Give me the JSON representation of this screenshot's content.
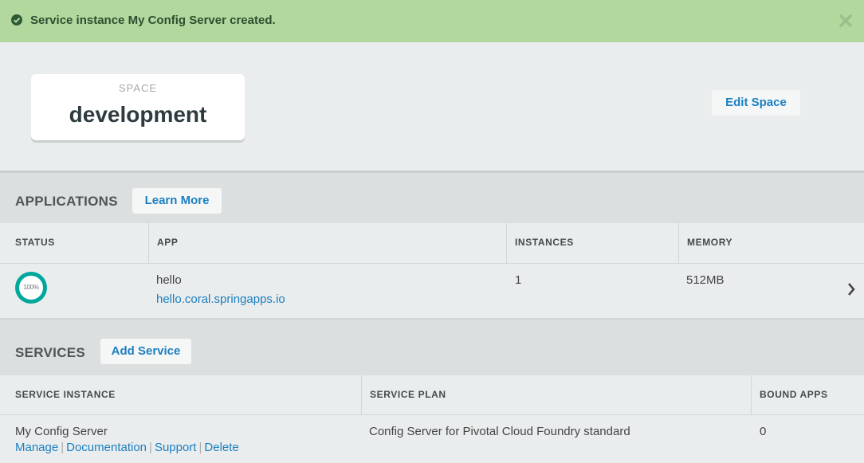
{
  "alert": {
    "prefix": "Service instance",
    "name": "My Config Server",
    "suffix": "created.",
    "status_color": "#b2d89e"
  },
  "space": {
    "label": "SPACE",
    "name": "development",
    "edit_label": "Edit Space"
  },
  "applications": {
    "title": "APPLICATIONS",
    "learn_more": "Learn More",
    "columns": [
      "STATUS",
      "APP",
      "INSTANCES",
      "MEMORY"
    ],
    "rows": [
      {
        "status_percent": "100%",
        "status_fraction": 1.0,
        "name": "hello",
        "route": "hello.coral.springapps.io",
        "instances": "1",
        "memory": "512MB"
      }
    ]
  },
  "services": {
    "title": "SERVICES",
    "add_label": "Add Service",
    "columns": [
      "SERVICE INSTANCE",
      "SERVICE PLAN",
      "BOUND APPS"
    ],
    "rows": [
      {
        "name": "My Config Server",
        "actions": [
          "Manage",
          "Documentation",
          "Support",
          "Delete"
        ],
        "plan": "Config Server for Pivotal Cloud Foundry standard",
        "bound_apps": "0"
      }
    ]
  },
  "colors": {
    "accent": "#1b7fc0",
    "status_ring": "#00a79d"
  }
}
